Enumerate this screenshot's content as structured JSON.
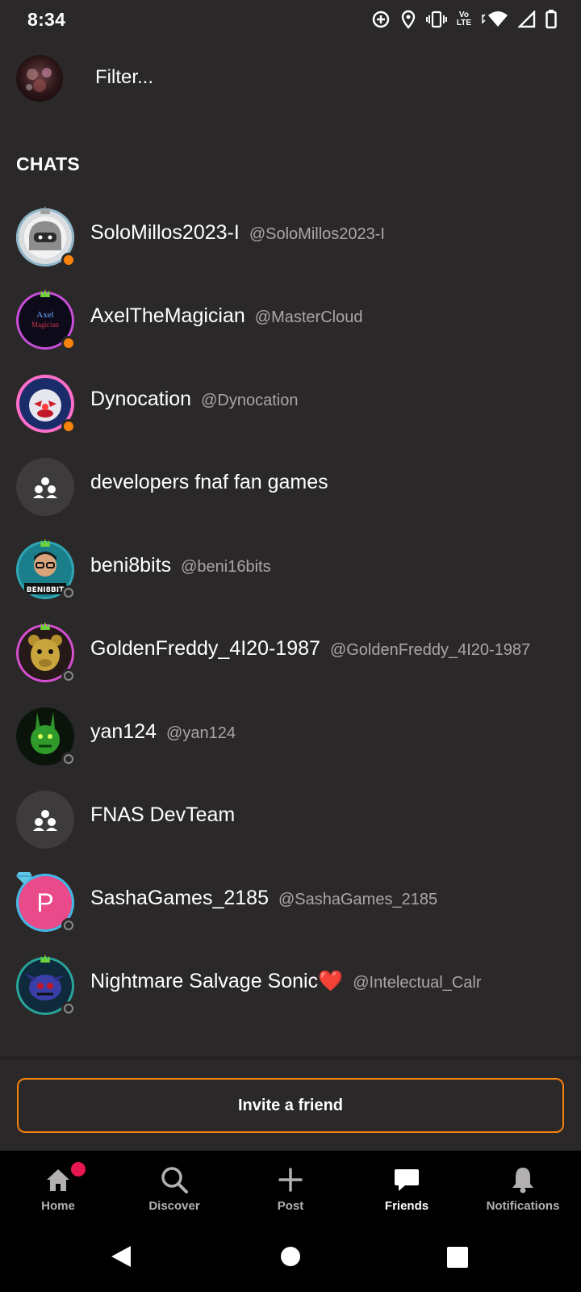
{
  "status_bar": {
    "time": "8:34",
    "volte_top": "Vo",
    "volte_bottom": "LTE"
  },
  "header": {
    "filter_placeholder": "Filter..."
  },
  "section_title": "CHATS",
  "chats": [
    {
      "name": "SoloMillos2023-I",
      "handle": "@SoloMillos2023-I",
      "status": "online",
      "avatar": "robot-avatar"
    },
    {
      "name": "AxelTheMagician",
      "handle": "@MasterCloud",
      "status": "online",
      "avatar": "magician-avatar"
    },
    {
      "name": "Dynocation",
      "handle": "@Dynocation",
      "status": "online",
      "avatar": "clown-avatar"
    },
    {
      "name": "developers fnaf fan games",
      "handle": "",
      "status": "group",
      "avatar": "group-icon"
    },
    {
      "name": "beni8bits",
      "handle": "@beni16bits",
      "status": "offline",
      "avatar": "gamer-avatar"
    },
    {
      "name": "GoldenFreddy_4I20-1987",
      "handle": "@GoldenFreddy_4I20-1987",
      "status": "offline",
      "avatar": "bear-avatar"
    },
    {
      "name": "yan124",
      "handle": "@yan124",
      "status": "offline",
      "avatar": "green-rabbit-avatar"
    },
    {
      "name": "FNAS DevTeam",
      "handle": "",
      "status": "group",
      "avatar": "group-icon"
    },
    {
      "name": "SashaGames_2185",
      "handle": "@SashaGames_2185",
      "status": "offline",
      "avatar": "letter-avatar",
      "avatar_letter": "P"
    },
    {
      "name": "Nightmare Salvage Sonic❤️",
      "handle": "@Intelectual_Calr",
      "status": "offline",
      "avatar": "sonic-avatar"
    }
  ],
  "invite_button": "Invite a friend",
  "bottom_nav": [
    {
      "label": "Home",
      "icon": "home-icon",
      "active": false,
      "badge": true
    },
    {
      "label": "Discover",
      "icon": "search-icon",
      "active": false
    },
    {
      "label": "Post",
      "icon": "plus-icon",
      "active": false
    },
    {
      "label": "Friends",
      "icon": "chat-bubble-icon",
      "active": true
    },
    {
      "label": "Notifications",
      "icon": "bell-icon",
      "active": false
    }
  ],
  "colors": {
    "background": "#2b2829",
    "accent": "#f7820c",
    "badge": "#e8174f",
    "nav_bg": "#000000"
  }
}
